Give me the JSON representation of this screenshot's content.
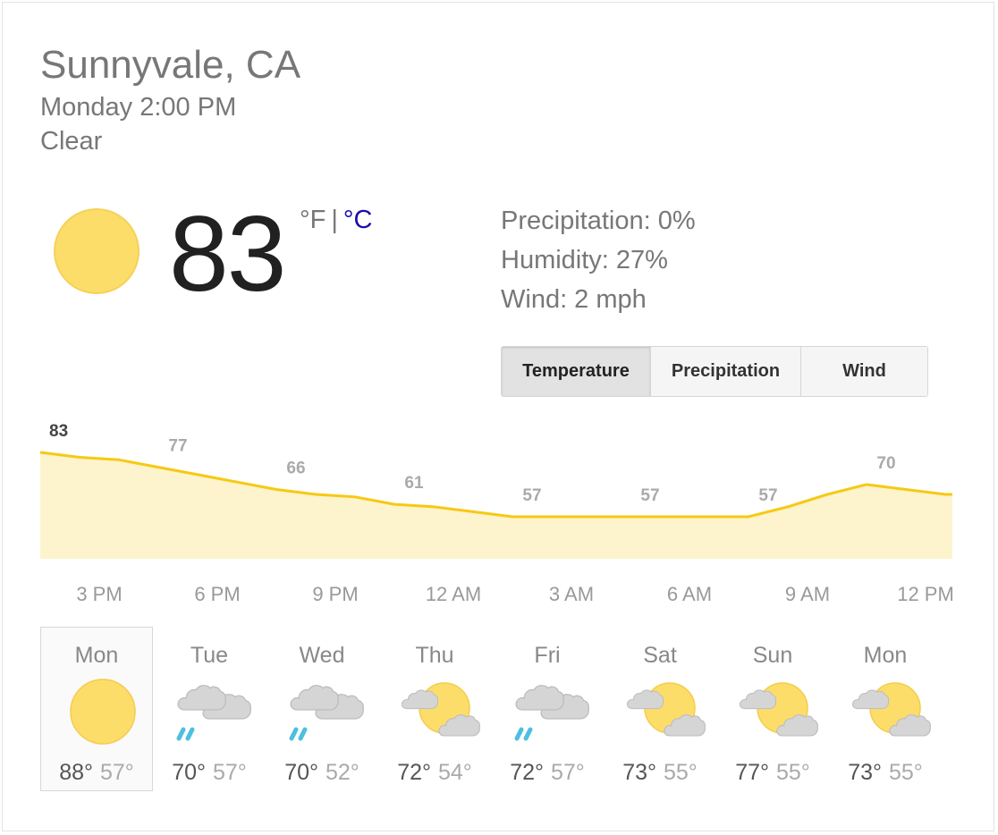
{
  "location": "Sunnyvale, CA",
  "datetime": "Monday 2:00 PM",
  "condition": "Clear",
  "current": {
    "temperature": "83",
    "unit_f": "°F",
    "unit_sep": "|",
    "unit_c": "°C",
    "icon": "sunny-icon",
    "details": {
      "precipitation": "Precipitation: 0%",
      "humidity": "Humidity: 27%",
      "wind": "Wind: 2 mph"
    }
  },
  "tabs": {
    "temperature": "Temperature",
    "precipitation": "Precipitation",
    "wind": "Wind",
    "active": "temperature"
  },
  "chart_data": {
    "type": "area",
    "x": [
      "2 PM",
      "3 PM",
      "4 PM",
      "5 PM",
      "6 PM",
      "7 PM",
      "8 PM",
      "9 PM",
      "10 PM",
      "11 PM",
      "12 AM",
      "1 AM",
      "2 AM",
      "3 AM",
      "4 AM",
      "5 AM",
      "6 AM",
      "7 AM",
      "8 AM",
      "9 AM",
      "10 AM",
      "11 AM",
      "12 PM",
      "1 PM"
    ],
    "values": [
      83,
      81,
      80,
      77,
      74,
      71,
      68,
      66,
      65,
      62,
      61,
      59,
      57,
      57,
      57,
      57,
      57,
      57,
      57,
      61,
      66,
      70,
      68,
      66
    ],
    "point_labels": [
      {
        "x": "2 PM",
        "text": "83"
      },
      {
        "x": "5 PM",
        "text": "77"
      },
      {
        "x": "8 PM",
        "text": "66"
      },
      {
        "x": "11 PM",
        "text": "61"
      },
      {
        "x": "2 AM",
        "text": "57"
      },
      {
        "x": "5 AM",
        "text": "57"
      },
      {
        "x": "8 AM",
        "text": "57"
      },
      {
        "x": "11 AM",
        "text": "70"
      }
    ],
    "tick_labels": [
      {
        "x": "3 PM",
        "text": "3 PM"
      },
      {
        "x": "6 PM",
        "text": "6 PM"
      },
      {
        "x": "9 PM",
        "text": "9 PM"
      },
      {
        "x": "12 AM",
        "text": "12 AM"
      },
      {
        "x": "3 AM",
        "text": "3 AM"
      },
      {
        "x": "6 AM",
        "text": "6 AM"
      },
      {
        "x": "9 AM",
        "text": "9 AM"
      },
      {
        "x": "12 PM",
        "text": "12 PM"
      }
    ],
    "ylim": [
      40,
      83
    ],
    "grid": false,
    "colors": {
      "line": "#f6c913",
      "fill": "#fdf3cc"
    }
  },
  "forecast": [
    {
      "day": "Mon",
      "icon": "sunny-icon",
      "hi": "88°",
      "lo": "57°",
      "selected": true
    },
    {
      "day": "Tue",
      "icon": "cloud-rain-icon",
      "hi": "70°",
      "lo": "57°"
    },
    {
      "day": "Wed",
      "icon": "cloud-rain-icon",
      "hi": "70°",
      "lo": "52°"
    },
    {
      "day": "Thu",
      "icon": "partly-cloudy-icon",
      "hi": "72°",
      "lo": "54°"
    },
    {
      "day": "Fri",
      "icon": "cloud-rain-icon",
      "hi": "72°",
      "lo": "57°"
    },
    {
      "day": "Sat",
      "icon": "partly-cloudy-icon",
      "hi": "73°",
      "lo": "55°"
    },
    {
      "day": "Sun",
      "icon": "partly-cloudy-icon",
      "hi": "77°",
      "lo": "55°"
    },
    {
      "day": "Mon",
      "icon": "partly-cloudy-icon",
      "hi": "73°",
      "lo": "55°"
    }
  ],
  "colors": {
    "sun": "#fddd6a",
    "sun_edge": "#f3cd4b",
    "cloud": "#d5d5d5",
    "cloud_edge": "#bdbdbd",
    "rain": "#4dbfe0",
    "link": "#1a0dab"
  }
}
